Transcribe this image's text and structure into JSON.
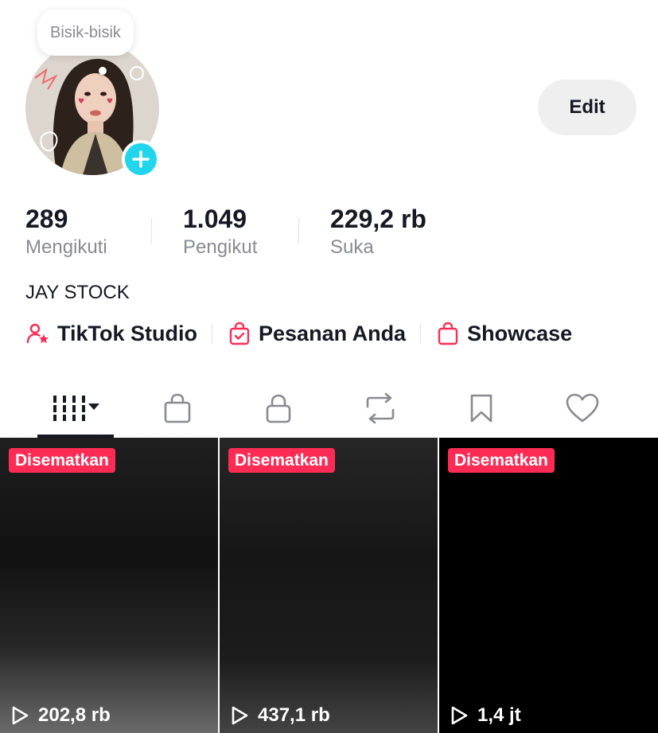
{
  "profile": {
    "note_bubble": "Bisik-bisik",
    "edit_label": "Edit",
    "display_name": "JAY STOCK"
  },
  "stats": [
    {
      "value": "289",
      "label": "Mengikuti"
    },
    {
      "value": "1.049",
      "label": "Pengikut"
    },
    {
      "value": "229,2 rb",
      "label": "Suka"
    }
  ],
  "links": [
    {
      "icon": "user-star-icon",
      "label": "TikTok Studio"
    },
    {
      "icon": "order-bag-icon",
      "label": "Pesanan Anda"
    },
    {
      "icon": "shopping-bag-icon",
      "label": "Showcase"
    }
  ],
  "tabs": [
    {
      "icon": "grid-videos-icon",
      "selected": true
    },
    {
      "icon": "shop-bag-icon"
    },
    {
      "icon": "lock-icon"
    },
    {
      "icon": "repost-icon"
    },
    {
      "icon": "bookmark-icon"
    },
    {
      "icon": "heart-icon"
    }
  ],
  "videos": [
    {
      "pinned_label": "Disematkan",
      "views": "202,8 rb"
    },
    {
      "pinned_label": "Disematkan",
      "views": "437,1 rb"
    },
    {
      "pinned_label": "Disematkan",
      "views": "1,4 jt"
    }
  ],
  "colors": {
    "accent_red": "#fe2c55",
    "add_badge": "#20d5ec",
    "text_primary": "#161823",
    "text_secondary": "#8a8b91"
  }
}
